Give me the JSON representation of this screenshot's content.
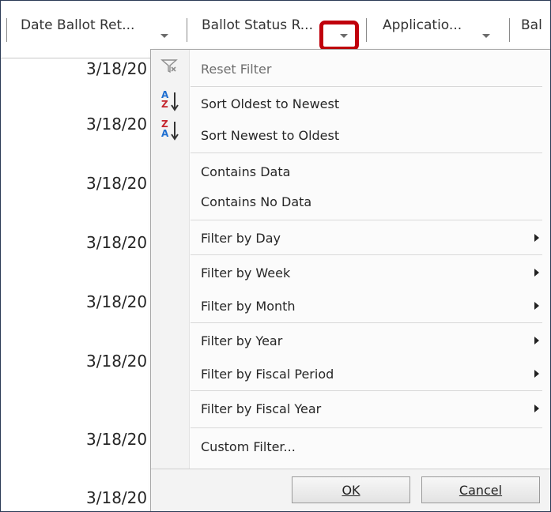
{
  "header": {
    "columns": [
      {
        "label": "Date Ballot Ret..."
      },
      {
        "label": "Ballot Status R..."
      },
      {
        "label": "Applicatio..."
      },
      {
        "label": "Bal"
      }
    ]
  },
  "rows": [
    "3/18/20",
    "3/18/20",
    "3/18/20",
    "3/18/20",
    "3/18/20",
    "3/18/20",
    "3/18/20",
    "3/18/20"
  ],
  "menu": {
    "reset": "Reset Filter",
    "sort_asc": "Sort Oldest to Newest",
    "sort_desc": "Sort Newest to Oldest",
    "contains": "Contains Data",
    "no_data": "Contains No Data",
    "by_day": "Filter by Day",
    "by_week": "Filter by Week",
    "by_month": "Filter by Month",
    "by_year": "Filter by Year",
    "by_fiscal_period": "Filter by Fiscal Period",
    "by_fiscal_year": "Filter by Fiscal Year",
    "custom": "Custom Filter...",
    "ok": "OK",
    "cancel": "Cancel"
  },
  "colors": {
    "highlight": "#c0000c",
    "frame": "#2b3a55"
  }
}
